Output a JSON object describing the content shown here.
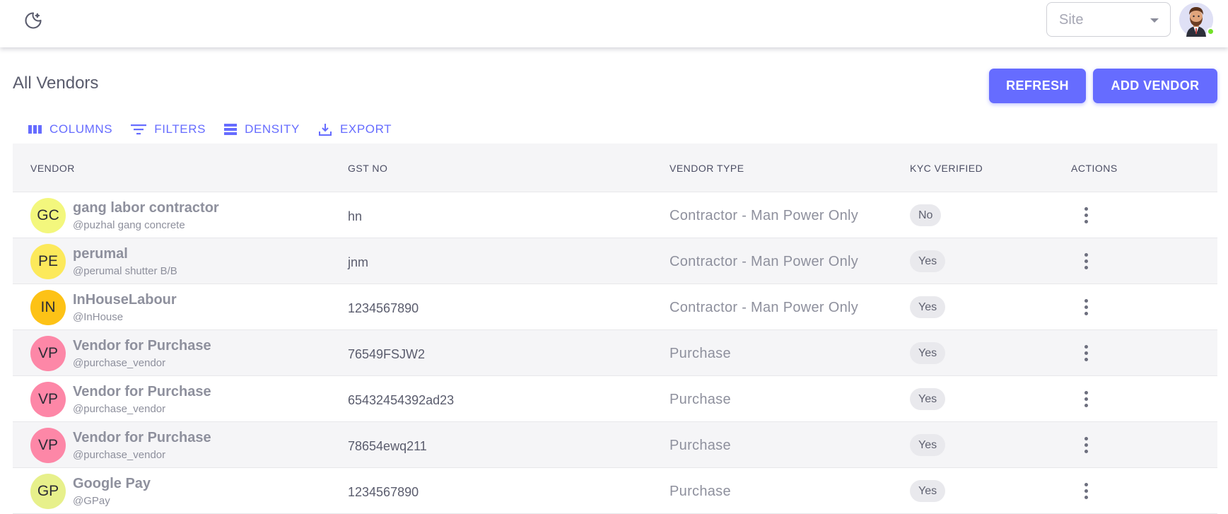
{
  "header": {
    "theme_icon": "moon-stars-icon",
    "site_select_placeholder": "Site",
    "avatar_icon": "user-avatar"
  },
  "page": {
    "title": "All Vendors",
    "refresh_label": "REFRESH",
    "add_vendor_label": "ADD VENDOR"
  },
  "toolbar": {
    "columns_label": "COLUMNS",
    "filters_label": "FILTERS",
    "density_label": "DENSITY",
    "export_label": "EXPORT"
  },
  "table": {
    "headers": [
      "VENDOR",
      "GST NO",
      "VENDOR TYPE",
      "KYC VERIFIED",
      "ACTIONS"
    ],
    "rows": [
      {
        "initials": "GC",
        "avatar_color": "#f3f77d",
        "name": "gang labor contractor",
        "handle": "@puzhal gang concrete",
        "gst": "hn",
        "type": "Contractor - Man Power Only",
        "kyc": "No"
      },
      {
        "initials": "PE",
        "avatar_color": "#fce95b",
        "name": "perumal",
        "handle": "@perumal shutter B/B",
        "gst": "jnm",
        "type": "Contractor - Man Power Only",
        "kyc": "Yes"
      },
      {
        "initials": "IN",
        "avatar_color": "#fdc216",
        "name": "InHouseLabour",
        "handle": "@InHouse",
        "gst": "1234567890",
        "type": "Contractor - Man Power Only",
        "kyc": "Yes"
      },
      {
        "initials": "VP",
        "avatar_color": "#fd87a7",
        "name": "Vendor for Purchase",
        "handle": "@purchase_vendor",
        "gst": "76549FSJW2",
        "type": "Purchase",
        "kyc": "Yes"
      },
      {
        "initials": "VP",
        "avatar_color": "#fd87a7",
        "name": "Vendor for Purchase",
        "handle": "@purchase_vendor",
        "gst": "65432454392ad23",
        "type": "Purchase",
        "kyc": "Yes"
      },
      {
        "initials": "VP",
        "avatar_color": "#fd87a7",
        "name": "Vendor for Purchase",
        "handle": "@purchase_vendor",
        "gst": "78654ewq211",
        "type": "Purchase",
        "kyc": "Yes"
      },
      {
        "initials": "GP",
        "avatar_color": "#e7f08b",
        "name": "Google Pay",
        "handle": "@GPay",
        "gst": "1234567890",
        "type": "Purchase",
        "kyc": "Yes"
      }
    ]
  }
}
